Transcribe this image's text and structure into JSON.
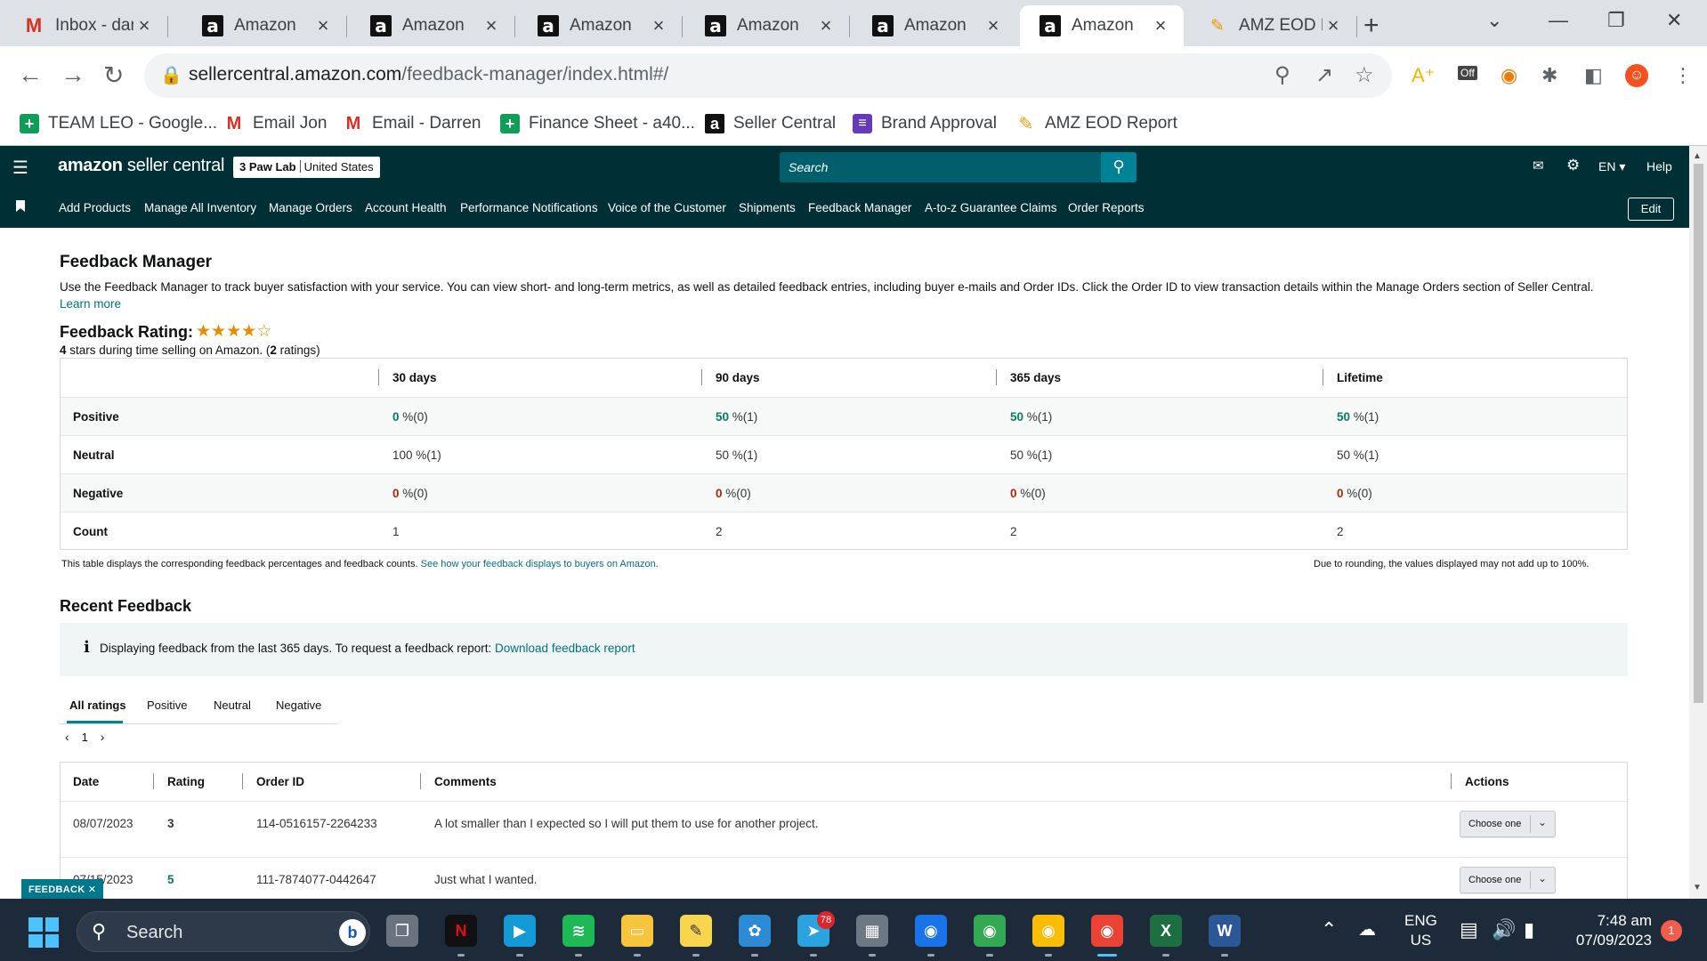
{
  "browser": {
    "tabs": [
      {
        "title": "Inbox - dar",
        "icon": "gmail-icon"
      },
      {
        "title": "Amazon",
        "icon": "amazon-icon"
      },
      {
        "title": "Amazon",
        "icon": "amazon-icon"
      },
      {
        "title": "Amazon",
        "icon": "amazon-icon"
      },
      {
        "title": "Amazon",
        "icon": "amazon-icon"
      },
      {
        "title": "Amazon",
        "icon": "amazon-icon"
      },
      {
        "title": "Amazon",
        "icon": "amazon-icon",
        "active": true
      },
      {
        "title": "AMZ EOD R",
        "icon": "eod-report-icon"
      }
    ],
    "url_host": "sellercentral.amazon.com",
    "url_path": "/feedback-manager/index.html#/",
    "bookmarks": [
      {
        "label": "TEAM LEO - Google...",
        "icon": "sheets-icon"
      },
      {
        "label": "Email Jon",
        "icon": "gmail-icon"
      },
      {
        "label": "Email - Darren",
        "icon": "gmail-icon"
      },
      {
        "label": "Finance Sheet - a40...",
        "icon": "sheets-icon"
      },
      {
        "label": "Seller Central",
        "icon": "amazon-icon"
      },
      {
        "label": "Brand Approval",
        "icon": "forms-icon"
      },
      {
        "label": "AMZ EOD Report",
        "icon": "eod-report-icon"
      }
    ],
    "ext_off_label": "Off"
  },
  "header": {
    "logo_bold": "amazon",
    "logo_rest": " seller central",
    "store_name": "3 Paw Lab",
    "store_region": "United States",
    "search_placeholder": "Search",
    "language": "EN",
    "help": "Help",
    "edit": "Edit"
  },
  "nav": [
    "Add Products",
    "Manage All Inventory",
    "Manage Orders",
    "Account Health",
    "Performance Notifications",
    "Voice of the Customer",
    "Shipments",
    "Feedback Manager",
    "A-to-z Guarantee Claims",
    "Order Reports"
  ],
  "page": {
    "title": "Feedback Manager",
    "intro": "Use the Feedback Manager to track buyer satisfaction with your service. You can view short- and long-term metrics, as well as detailed feedback entries, including buyer e-mails and Order IDs. Click the Order ID to view transaction details within the Manage Orders section of Seller Central.",
    "learn_more": "Learn more",
    "rating_title": "Feedback Rating:",
    "rating_stars": 4,
    "rating_max": 5,
    "rating_sub_stars": "4",
    "rating_sub_mid": " stars during time selling on Amazon. (",
    "rating_sub_count": "2",
    "rating_sub_end": " ratings)"
  },
  "rating_table": {
    "columns": [
      "30 days",
      "90 days",
      "365 days",
      "Lifetime"
    ],
    "rows": [
      {
        "label": "Positive",
        "kind": "pos",
        "cells": [
          {
            "n": "0",
            "s": " %(0)"
          },
          {
            "n": "50",
            "s": " %(1)"
          },
          {
            "n": "50",
            "s": " %(1)"
          },
          {
            "n": "50",
            "s": " %(1)"
          }
        ]
      },
      {
        "label": "Neutral",
        "kind": "neu",
        "cells": [
          {
            "n": "100",
            "s": " %(1)"
          },
          {
            "n": "50",
            "s": " %(1)"
          },
          {
            "n": "50",
            "s": " %(1)"
          },
          {
            "n": "50",
            "s": " %(1)"
          }
        ]
      },
      {
        "label": "Negative",
        "kind": "neg",
        "cells": [
          {
            "n": "0",
            "s": " %(0)"
          },
          {
            "n": "0",
            "s": " %(0)"
          },
          {
            "n": "0",
            "s": " %(0)"
          },
          {
            "n": "0",
            "s": " %(0)"
          }
        ]
      },
      {
        "label": "Count",
        "kind": "count",
        "cells": [
          {
            "n": "1",
            "s": ""
          },
          {
            "n": "2",
            "s": ""
          },
          {
            "n": "2",
            "s": ""
          },
          {
            "n": "2",
            "s": ""
          }
        ]
      }
    ],
    "footnote": "This table displays the corresponding feedback percentages and feedback counts.",
    "footnote_link": "See how your feedback displays to buyers on Amazon.",
    "rounding_note": "Due to rounding, the values displayed may not add up to 100%."
  },
  "recent": {
    "title": "Recent Feedback",
    "info_icon": "i",
    "info_text": "Displaying feedback from the last 365 days. To request a feedback report:",
    "info_link": "Download feedback report",
    "tabs": [
      "All ratings",
      "Positive",
      "Neutral",
      "Negative"
    ],
    "page": "1",
    "columns": [
      "Date",
      "Rating",
      "Order ID",
      "Comments",
      "Actions"
    ],
    "rows": [
      {
        "date": "08/07/2023",
        "rating": "3",
        "order_id": "114-0516157-2264233",
        "comment": "A lot smaller than I expected so I will put them to use for another project.",
        "action": "Choose one"
      },
      {
        "date": "07/15/2023",
        "rating": "5",
        "order_id": "111-7874077-0442647",
        "comment": "Just what I wanted.",
        "action": "Choose one"
      }
    ],
    "feedback_tab": "FEEDBACK ✕"
  },
  "taskbar": {
    "search": "Search",
    "telegram_badge": "78",
    "lang_1": "ENG",
    "lang_2": "US",
    "time": "7:48 am",
    "date": "07/09/2023",
    "notifications": "1"
  }
}
